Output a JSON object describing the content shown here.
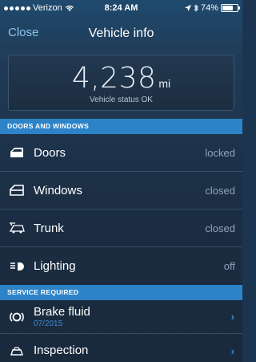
{
  "status_bar": {
    "carrier": "Verizon",
    "time": "8:24 AM",
    "battery": "74%",
    "battery_level": 0.74
  },
  "nav": {
    "close_label": "Close",
    "title": "Vehicle info"
  },
  "odometer": {
    "value": "4,238",
    "unit": "mi",
    "status": "Vehicle status OK"
  },
  "doors_windows": {
    "header": "DOORS AND WINDOWS",
    "items": [
      {
        "label": "Doors",
        "value": "locked",
        "icon": "door-icon"
      },
      {
        "label": "Windows",
        "value": "closed",
        "icon": "window-icon"
      },
      {
        "label": "Trunk",
        "value": "closed",
        "icon": "trunk-icon"
      },
      {
        "label": "Lighting",
        "value": "off",
        "icon": "light-icon"
      }
    ]
  },
  "service": {
    "header": "SERVICE REQUIRED",
    "items": [
      {
        "label": "Brake fluid",
        "date": "07/2015",
        "icon": "brake-icon"
      },
      {
        "label": "Inspection",
        "date": "",
        "icon": "inspection-icon"
      }
    ]
  }
}
